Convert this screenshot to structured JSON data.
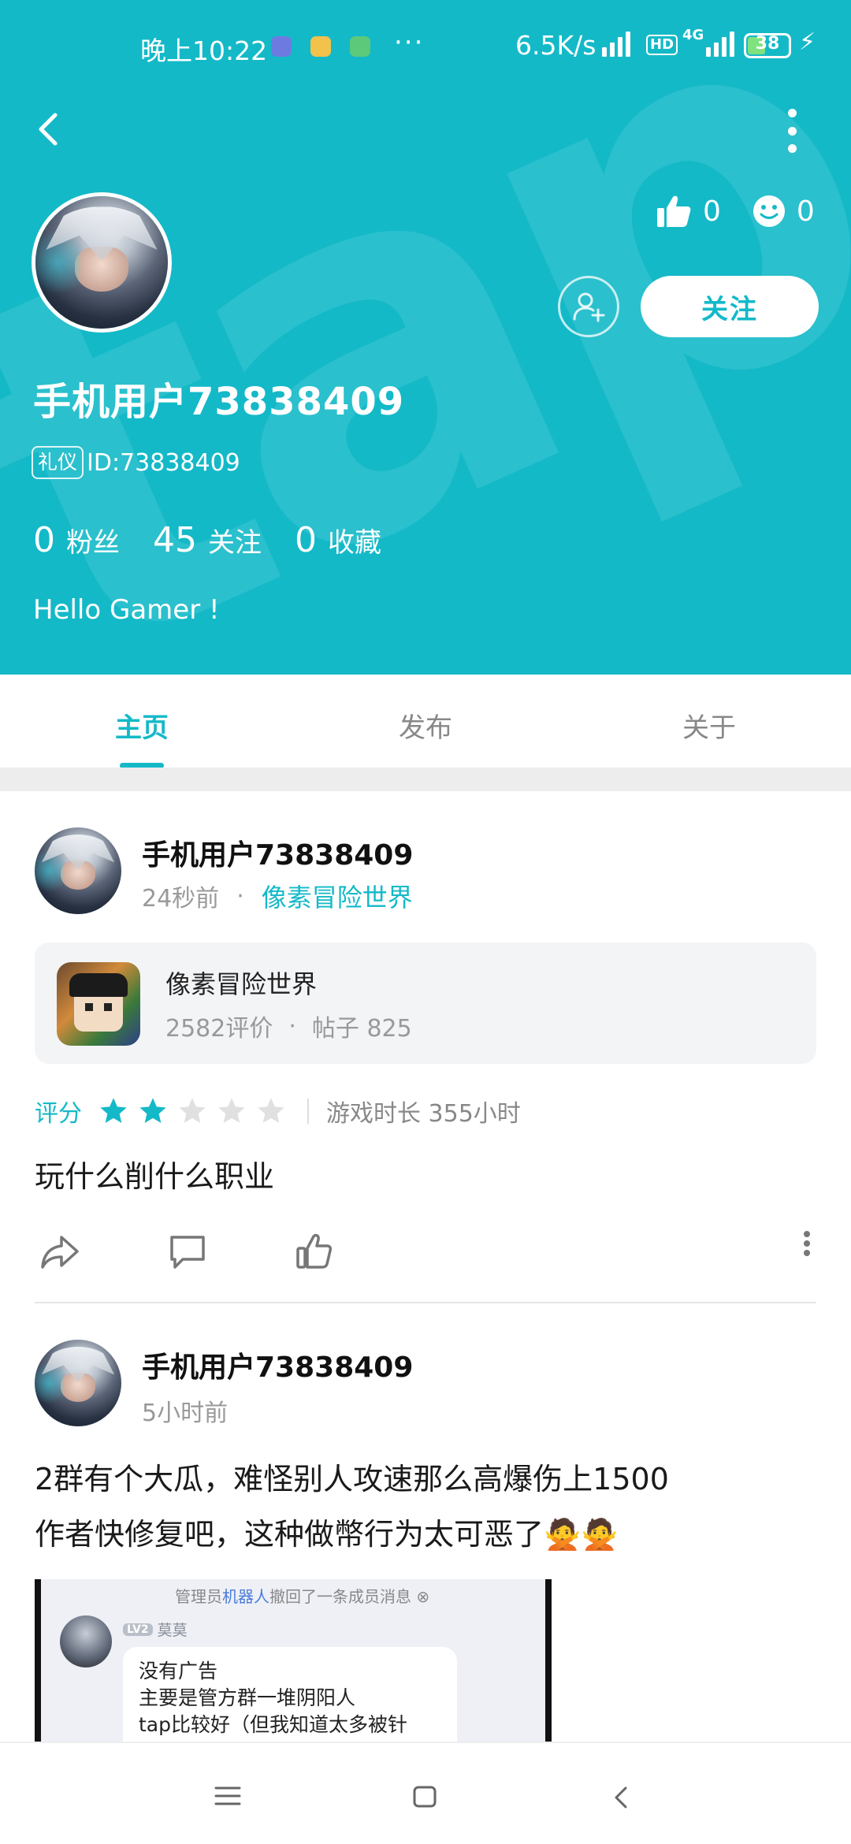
{
  "status_bar": {
    "time": "晚上10:22",
    "more": "···",
    "net_speed": "6.5K/s",
    "hd": "HD",
    "network": "4G",
    "battery": "38"
  },
  "header": {
    "bg_color": "#14b9c8",
    "watermark": "tap",
    "likes": "0",
    "smiles": "0",
    "follow_label": "关注",
    "username": "手机用户73838409",
    "badge": "礼仪",
    "id_text": "ID:73838409",
    "stats": [
      {
        "num": "0",
        "label": "粉丝"
      },
      {
        "num": "45",
        "label": "关注"
      },
      {
        "num": "0",
        "label": "收藏"
      }
    ],
    "bio": "Hello Gamer !"
  },
  "tabs": [
    {
      "label": "主页",
      "active": true
    },
    {
      "label": "发布",
      "active": false
    },
    {
      "label": "关于",
      "active": false
    }
  ],
  "posts": [
    {
      "author": "手机用户73838409",
      "time": "24秒前",
      "dot": "·",
      "game": "像素冒险世界",
      "card": {
        "title": "像素冒险世界",
        "reviews": "2582评价",
        "dot": "·",
        "posts": "帖子 825"
      },
      "rating_label": "评分",
      "stars": 2,
      "stars_max": 5,
      "playtime": "游戏时长 355小时",
      "text": "玩什么削什么职业"
    },
    {
      "author": "手机用户73838409",
      "time": "5小时前",
      "text_line1": "2群有个大瓜，难怪别人攻速那么高爆伤上1500",
      "text_line2": "作者快修复吧，这种做幣行为太可恶了🙅🙅",
      "screenshot": {
        "notice_pre": "管理员",
        "notice_hl": "机器人",
        "notice_post": "撤回了一条成员消息",
        "level": "LV2",
        "name": "莫莫",
        "line1": "没有广告",
        "line2": "主要是管方群一堆阴阳人",
        "line3": "tap比较好（但我知道太多被针"
      }
    }
  ],
  "colors": {
    "accent": "#14b9c8",
    "star_on": "#14b9c8",
    "star_off": "#e0e0e0"
  }
}
